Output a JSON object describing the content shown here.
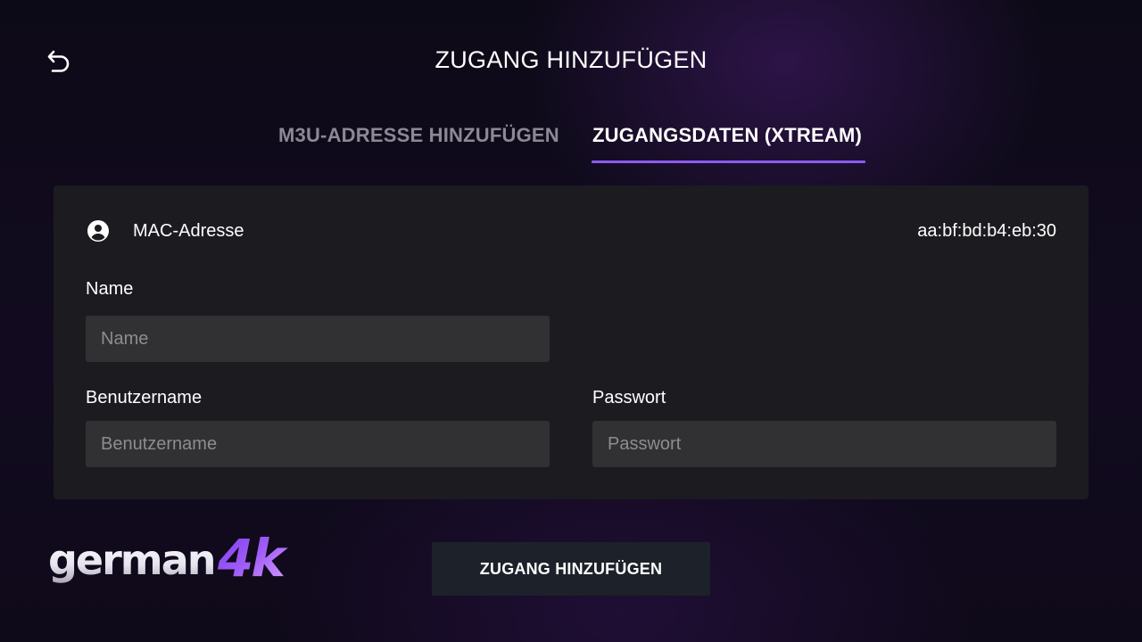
{
  "header": {
    "back_icon": "back-arrow-icon",
    "title": "ZUGANG HINZUFÜGEN"
  },
  "tabs": [
    {
      "label": "M3U-ADRESSE HINZUFÜGEN",
      "active": false
    },
    {
      "label": "ZUGANGSDATEN (XTREAM)",
      "active": true
    }
  ],
  "form": {
    "mac": {
      "icon": "account-circle-icon",
      "label": "MAC-Adresse",
      "value": "aa:bf:bd:b4:eb:30"
    },
    "name": {
      "label": "Name",
      "value": "",
      "placeholder": "Name"
    },
    "username": {
      "label": "Benutzername",
      "value": "",
      "placeholder": "Benutzername"
    },
    "password": {
      "label": "Passwort",
      "value": "",
      "placeholder": "Passwort"
    }
  },
  "logo": {
    "text_main": "german",
    "text_accent": "4k"
  },
  "submit": {
    "label": "ZUGANG HINZUFÜGEN"
  },
  "colors": {
    "accent": "#8a5cf0",
    "panel": "#1c1b20",
    "input": "#313033",
    "button": "#1d2129",
    "inactive_tab": "#8b8994"
  }
}
